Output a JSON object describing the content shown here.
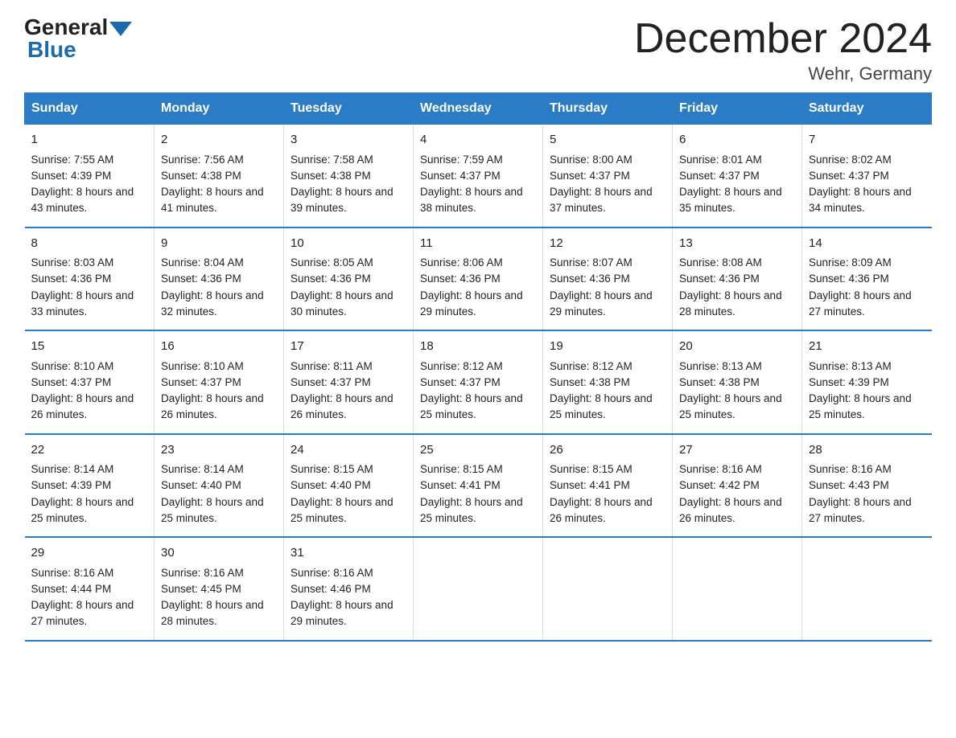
{
  "header": {
    "logo_general": "General",
    "logo_blue": "Blue",
    "month_title": "December 2024",
    "location": "Wehr, Germany"
  },
  "days_of_week": [
    "Sunday",
    "Monday",
    "Tuesday",
    "Wednesday",
    "Thursday",
    "Friday",
    "Saturday"
  ],
  "weeks": [
    [
      {
        "day": "1",
        "sunrise": "7:55 AM",
        "sunset": "4:39 PM",
        "daylight": "8 hours and 43 minutes."
      },
      {
        "day": "2",
        "sunrise": "7:56 AM",
        "sunset": "4:38 PM",
        "daylight": "8 hours and 41 minutes."
      },
      {
        "day": "3",
        "sunrise": "7:58 AM",
        "sunset": "4:38 PM",
        "daylight": "8 hours and 39 minutes."
      },
      {
        "day": "4",
        "sunrise": "7:59 AM",
        "sunset": "4:37 PM",
        "daylight": "8 hours and 38 minutes."
      },
      {
        "day": "5",
        "sunrise": "8:00 AM",
        "sunset": "4:37 PM",
        "daylight": "8 hours and 37 minutes."
      },
      {
        "day": "6",
        "sunrise": "8:01 AM",
        "sunset": "4:37 PM",
        "daylight": "8 hours and 35 minutes."
      },
      {
        "day": "7",
        "sunrise": "8:02 AM",
        "sunset": "4:37 PM",
        "daylight": "8 hours and 34 minutes."
      }
    ],
    [
      {
        "day": "8",
        "sunrise": "8:03 AM",
        "sunset": "4:36 PM",
        "daylight": "8 hours and 33 minutes."
      },
      {
        "day": "9",
        "sunrise": "8:04 AM",
        "sunset": "4:36 PM",
        "daylight": "8 hours and 32 minutes."
      },
      {
        "day": "10",
        "sunrise": "8:05 AM",
        "sunset": "4:36 PM",
        "daylight": "8 hours and 30 minutes."
      },
      {
        "day": "11",
        "sunrise": "8:06 AM",
        "sunset": "4:36 PM",
        "daylight": "8 hours and 29 minutes."
      },
      {
        "day": "12",
        "sunrise": "8:07 AM",
        "sunset": "4:36 PM",
        "daylight": "8 hours and 29 minutes."
      },
      {
        "day": "13",
        "sunrise": "8:08 AM",
        "sunset": "4:36 PM",
        "daylight": "8 hours and 28 minutes."
      },
      {
        "day": "14",
        "sunrise": "8:09 AM",
        "sunset": "4:36 PM",
        "daylight": "8 hours and 27 minutes."
      }
    ],
    [
      {
        "day": "15",
        "sunrise": "8:10 AM",
        "sunset": "4:37 PM",
        "daylight": "8 hours and 26 minutes."
      },
      {
        "day": "16",
        "sunrise": "8:10 AM",
        "sunset": "4:37 PM",
        "daylight": "8 hours and 26 minutes."
      },
      {
        "day": "17",
        "sunrise": "8:11 AM",
        "sunset": "4:37 PM",
        "daylight": "8 hours and 26 minutes."
      },
      {
        "day": "18",
        "sunrise": "8:12 AM",
        "sunset": "4:37 PM",
        "daylight": "8 hours and 25 minutes."
      },
      {
        "day": "19",
        "sunrise": "8:12 AM",
        "sunset": "4:38 PM",
        "daylight": "8 hours and 25 minutes."
      },
      {
        "day": "20",
        "sunrise": "8:13 AM",
        "sunset": "4:38 PM",
        "daylight": "8 hours and 25 minutes."
      },
      {
        "day": "21",
        "sunrise": "8:13 AM",
        "sunset": "4:39 PM",
        "daylight": "8 hours and 25 minutes."
      }
    ],
    [
      {
        "day": "22",
        "sunrise": "8:14 AM",
        "sunset": "4:39 PM",
        "daylight": "8 hours and 25 minutes."
      },
      {
        "day": "23",
        "sunrise": "8:14 AM",
        "sunset": "4:40 PM",
        "daylight": "8 hours and 25 minutes."
      },
      {
        "day": "24",
        "sunrise": "8:15 AM",
        "sunset": "4:40 PM",
        "daylight": "8 hours and 25 minutes."
      },
      {
        "day": "25",
        "sunrise": "8:15 AM",
        "sunset": "4:41 PM",
        "daylight": "8 hours and 25 minutes."
      },
      {
        "day": "26",
        "sunrise": "8:15 AM",
        "sunset": "4:41 PM",
        "daylight": "8 hours and 26 minutes."
      },
      {
        "day": "27",
        "sunrise": "8:16 AM",
        "sunset": "4:42 PM",
        "daylight": "8 hours and 26 minutes."
      },
      {
        "day": "28",
        "sunrise": "8:16 AM",
        "sunset": "4:43 PM",
        "daylight": "8 hours and 27 minutes."
      }
    ],
    [
      {
        "day": "29",
        "sunrise": "8:16 AM",
        "sunset": "4:44 PM",
        "daylight": "8 hours and 27 minutes."
      },
      {
        "day": "30",
        "sunrise": "8:16 AM",
        "sunset": "4:45 PM",
        "daylight": "8 hours and 28 minutes."
      },
      {
        "day": "31",
        "sunrise": "8:16 AM",
        "sunset": "4:46 PM",
        "daylight": "8 hours and 29 minutes."
      },
      null,
      null,
      null,
      null
    ]
  ],
  "labels": {
    "sunrise_prefix": "Sunrise: ",
    "sunset_prefix": "Sunset: ",
    "daylight_prefix": "Daylight: "
  },
  "colors": {
    "header_bg": "#2a7cc7",
    "header_text": "#ffffff",
    "border": "#2a7cc7"
  }
}
